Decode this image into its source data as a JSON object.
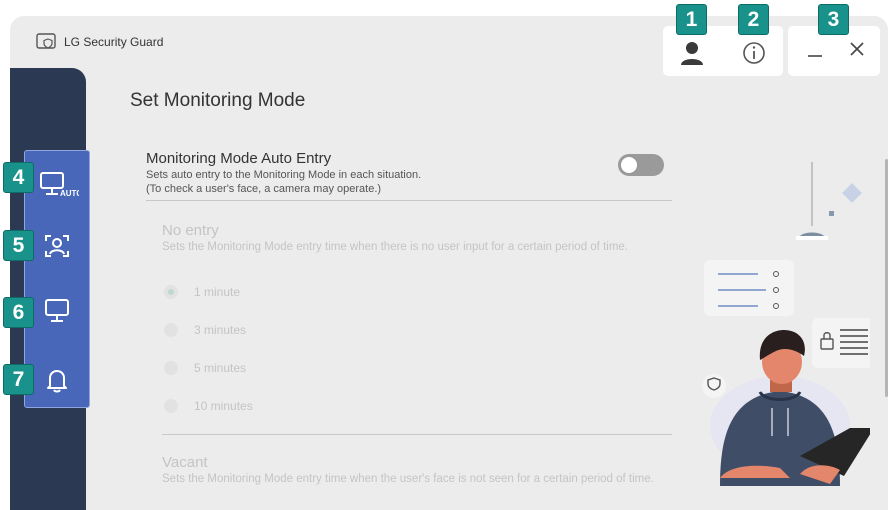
{
  "app": {
    "title": "LG Security Guard"
  },
  "page": {
    "title": "Set Monitoring Mode"
  },
  "auto_entry": {
    "title": "Monitoring Mode Auto Entry",
    "description_line1": "Sets auto entry to the Monitoring Mode in each situation.",
    "description_line2": "(To check a user's face, a camera may operate.)",
    "enabled": false
  },
  "no_entry": {
    "title": "No entry",
    "description": "Sets the Monitoring Mode entry time when there is no user input for a certain period of time.",
    "options": [
      "1 minute",
      "3 minutes",
      "5 minutes",
      "10 minutes"
    ],
    "selected": "1 minute"
  },
  "vacant": {
    "title": "Vacant",
    "description": "Sets the Monitoring Mode entry time when the user's face is not seen for a certain period of time."
  },
  "sidebar": {
    "items": [
      {
        "name": "auto-monitor",
        "icon": "monitor-auto-icon",
        "icon_text": "AUTO"
      },
      {
        "name": "face",
        "icon": "face-scan-icon"
      },
      {
        "name": "monitor",
        "icon": "monitor-icon"
      },
      {
        "name": "notifications",
        "icon": "bell-icon"
      }
    ]
  },
  "callouts": [
    "1",
    "2",
    "3",
    "4",
    "5",
    "6",
    "7"
  ],
  "colors": {
    "callout": "#18928a",
    "sidebar": "#2b3a52",
    "sidebar_active": "#4867b9"
  }
}
